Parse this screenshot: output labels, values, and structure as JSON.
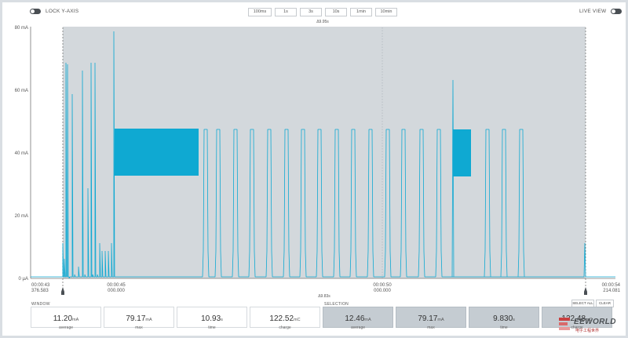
{
  "top": {
    "lock_label": "LOCK Y-AXIS",
    "live_label": "LIVE VIEW",
    "zoom": [
      "100ms",
      "1s",
      "3s",
      "10s",
      "1min",
      "10min"
    ]
  },
  "chart": {
    "y_ticks": [
      "80 mA",
      "60 mA",
      "40 mA",
      "20 mA",
      "0 µA"
    ],
    "top_annotation": "Δ9.95s",
    "bottom_annotation": "Δ9.83s",
    "x_labels": [
      {
        "t": "00:00:43",
        "s": "376.583"
      },
      {
        "t": "00:00:45",
        "s": "000.000"
      },
      {
        "t": "00:00:50",
        "s": "000.000"
      },
      {
        "t": "00:00:54",
        "s": "214.081"
      }
    ],
    "colors": {
      "trace": "#0fa9d2",
      "selection_bg": "#d3d8dc",
      "axis": "#777777"
    }
  },
  "window": {
    "label": "WINDOW",
    "stats": [
      {
        "value": "11.20",
        "unit": "mA",
        "label": "average"
      },
      {
        "value": "79.17",
        "unit": "mA",
        "label": "max"
      },
      {
        "value": "10.93",
        "unit": "s",
        "label": "time"
      },
      {
        "value": "122.52",
        "unit": "mC",
        "label": "charge"
      }
    ]
  },
  "selection": {
    "label": "SELECTION",
    "select_all": "SELECT ALL",
    "clear": "CLEAR",
    "stats": [
      {
        "value": "12.46",
        "unit": "mA",
        "label": "average"
      },
      {
        "value": "79.17",
        "unit": "mA",
        "label": "max"
      },
      {
        "value": "9.830",
        "unit": "s",
        "label": "time"
      },
      {
        "value": "122.48",
        "unit": "mC",
        "label": "charge"
      }
    ]
  },
  "watermark": {
    "title": "EEWORLD",
    "subtitle": "电子工程世界"
  }
}
